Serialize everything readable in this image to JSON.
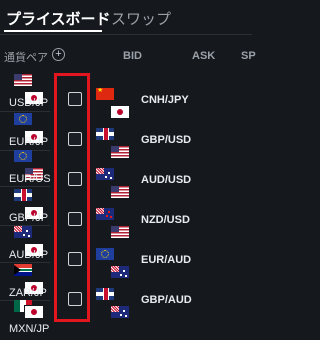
{
  "tabs": {
    "active_label": "プライスボード",
    "inactive_label": "スワップ"
  },
  "header": {
    "pair_label": "通貨ペア",
    "plus_symbol": "+",
    "bid_label": "BID",
    "ask_label": "ASK",
    "sp_label": "SP"
  },
  "pair_list": [
    {
      "label": "USD/JP"
    },
    {
      "label": "EUR/JP"
    },
    {
      "label": "EUR/US"
    },
    {
      "label": "GBP/JP"
    },
    {
      "label": "AUD/JP"
    },
    {
      "label": "ZAR/JP"
    },
    {
      "label": "MXN/JP"
    }
  ],
  "selected_pairs": [
    {
      "label": "CNH/JPY"
    },
    {
      "label": "GBP/USD"
    },
    {
      "label": "AUD/USD"
    },
    {
      "label": "NZD/USD"
    },
    {
      "label": "EUR/AUD"
    },
    {
      "label": "GBP/AUD"
    }
  ],
  "colors": {
    "background": "#15181d",
    "highlight_border": "#e3161f",
    "text": "#e9ecef",
    "muted": "#9aa1a8"
  }
}
